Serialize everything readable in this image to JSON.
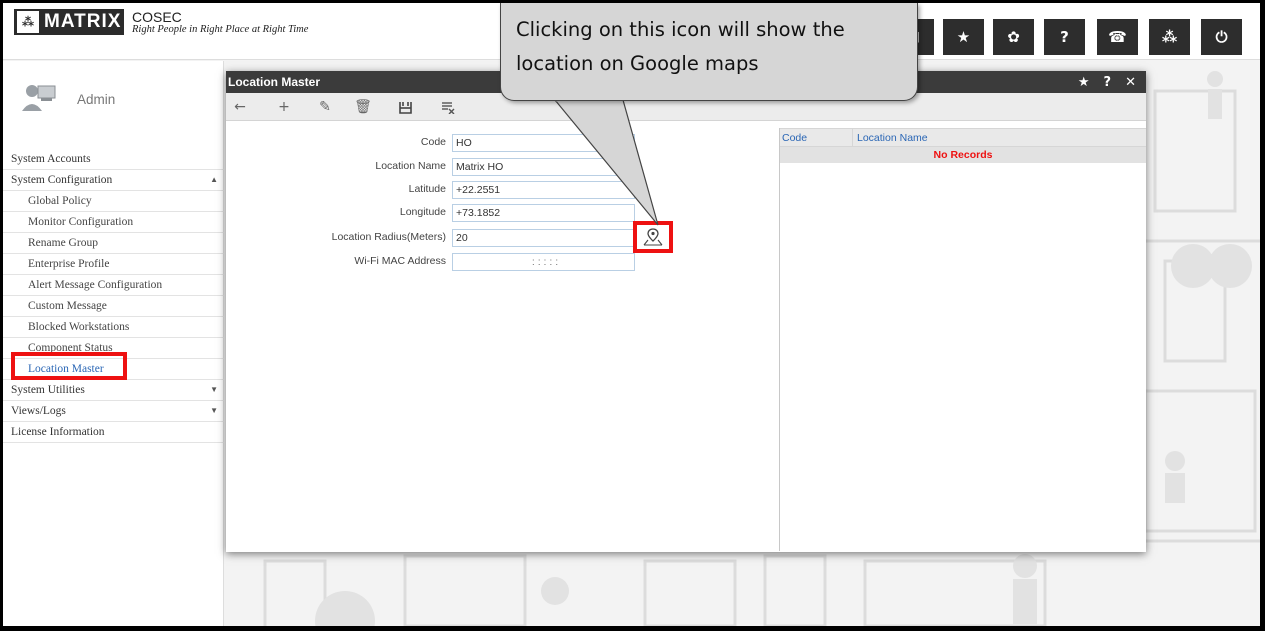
{
  "header": {
    "logo_text": "MATRIX",
    "product": "COSEC",
    "tagline": "Right People in Right Place at Right Time",
    "buttons": [
      {
        "name": "grid-icon",
        "glyph": "⊞"
      },
      {
        "name": "star-icon",
        "glyph": "★"
      },
      {
        "name": "gear-icon",
        "glyph": "✿"
      },
      {
        "name": "help-icon",
        "glyph": "?"
      },
      {
        "name": "phone-icon",
        "glyph": "☎"
      },
      {
        "name": "matrix-icon",
        "glyph": "⁂"
      },
      {
        "name": "power-icon",
        "glyph": "⏻"
      }
    ]
  },
  "sidebar": {
    "user": "Admin",
    "items": [
      {
        "label": "System Accounts",
        "level": 0
      },
      {
        "label": "System Configuration",
        "level": 0,
        "expanded": true
      },
      {
        "label": "Global Policy",
        "level": 1
      },
      {
        "label": "Monitor Configuration",
        "level": 1
      },
      {
        "label": "Rename Group",
        "level": 1
      },
      {
        "label": "Enterprise Profile",
        "level": 1
      },
      {
        "label": "Alert Message Configuration",
        "level": 1
      },
      {
        "label": "Custom Message",
        "level": 1
      },
      {
        "label": "Blocked Workstations",
        "level": 1
      },
      {
        "label": "Component Status",
        "level": 1
      },
      {
        "label": "Location Master",
        "level": 1,
        "active": true
      },
      {
        "label": "System Utilities",
        "level": 0,
        "collapsed": true
      },
      {
        "label": "Views/Logs",
        "level": 0,
        "collapsed": true
      },
      {
        "label": "License Information",
        "level": 0
      }
    ]
  },
  "dialog": {
    "title": "Location Master",
    "controls": [
      "★",
      "?",
      "✕"
    ],
    "form": {
      "code": {
        "label": "Code",
        "value": "HO"
      },
      "location_name": {
        "label": "Location Name",
        "value": "Matrix HO"
      },
      "latitude": {
        "label": "Latitude",
        "value": "+22.2551"
      },
      "longitude": {
        "label": "Longitude",
        "value": "+73.1852"
      },
      "radius": {
        "label": "Location Radius(Meters)",
        "value": "20"
      },
      "wifi_mac": {
        "label": "Wi-Fi MAC Address",
        "value": ":   :   :   :   :"
      }
    },
    "grid": {
      "columns": [
        "Code",
        "Location Name"
      ],
      "empty_text": "No Records"
    }
  },
  "callout": {
    "text": "Clicking on this icon will show the location on Google maps"
  },
  "colors": {
    "highlight": "#ee1111",
    "link": "#2a66b5",
    "dark": "#2d2d2d"
  }
}
